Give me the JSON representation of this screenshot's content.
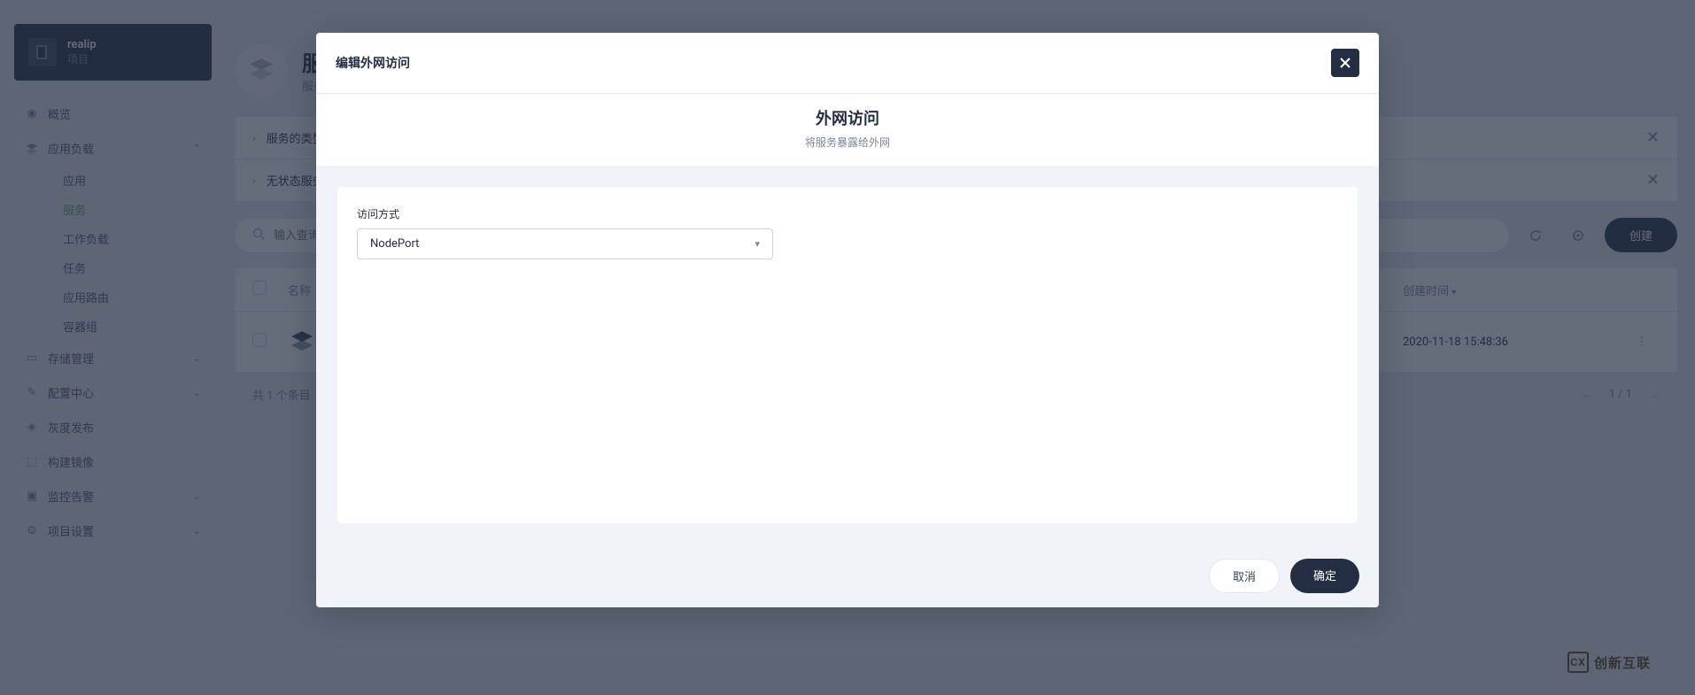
{
  "project": {
    "name": "realip",
    "label": "项目"
  },
  "sidebar": {
    "items": [
      {
        "label": "概览"
      },
      {
        "label": "应用负载"
      },
      {
        "label": "应用"
      },
      {
        "label": "服务"
      },
      {
        "label": "工作负载"
      },
      {
        "label": "任务"
      },
      {
        "label": "应用路由"
      },
      {
        "label": "容器组"
      },
      {
        "label": "存储管理"
      },
      {
        "label": "配置中心"
      },
      {
        "label": "灰度发布"
      },
      {
        "label": "构建镜像"
      },
      {
        "label": "监控告警"
      },
      {
        "label": "项目设置"
      }
    ]
  },
  "page": {
    "title": "服",
    "subtitle": "服务"
  },
  "accordion": {
    "row1": "服务的类型",
    "row2": "无状态服务相"
  },
  "toolbar": {
    "search_placeholder": "输入查询",
    "create": "创建"
  },
  "table": {
    "col_name": "名称",
    "col_time": "创建时间",
    "row_time": "2020-11-18 15:48:36",
    "footer_count": "共 1 个条目",
    "page_indicator": "1 / 1"
  },
  "modal": {
    "title": "编辑外网访问",
    "section_title": "外网访问",
    "section_sub": "将服务暴露给外网",
    "field_label": "访问方式",
    "select_value": "NodePort",
    "cancel": "取消",
    "confirm": "确定"
  },
  "watermark": "创新互联"
}
